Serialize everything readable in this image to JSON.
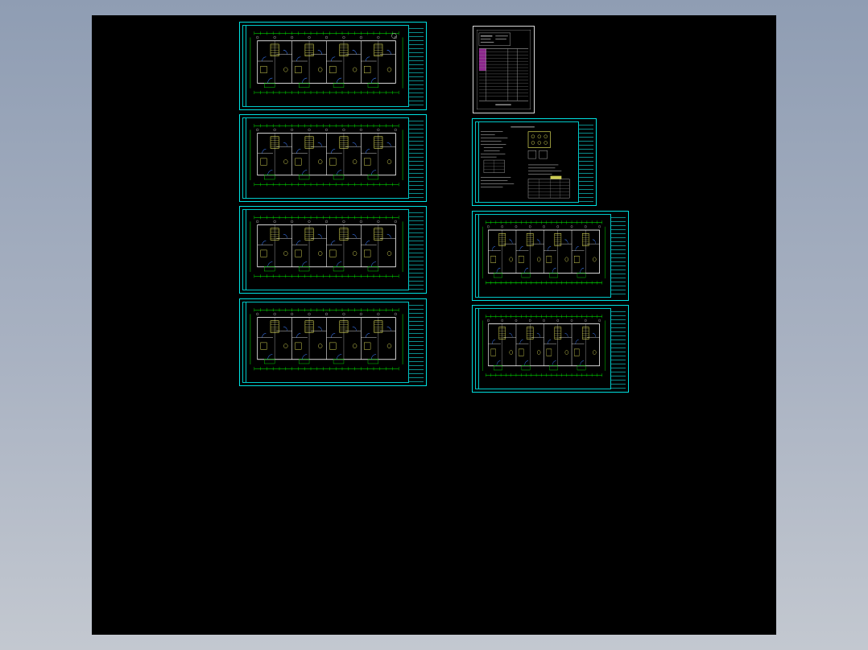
{
  "window": {
    "title": ""
  },
  "viewport": {
    "background": "#000000",
    "frame_color": "#00e0e0",
    "plan_colors": {
      "wall": "#ffffff",
      "dimension": "#00ff00",
      "furniture": "#ffff66",
      "door": "#3d7dff",
      "accent": "#ff44ff"
    }
  },
  "sheets": [
    {
      "id": "floor-plan-1",
      "kind": "floor-plan",
      "caption": ""
    },
    {
      "id": "floor-plan-2",
      "kind": "floor-plan",
      "caption": ""
    },
    {
      "id": "floor-plan-3",
      "kind": "floor-plan",
      "caption": ""
    },
    {
      "id": "floor-plan-4",
      "kind": "floor-plan",
      "caption": ""
    },
    {
      "id": "drawing-index",
      "kind": "schedule",
      "caption": ""
    },
    {
      "id": "design-notes",
      "kind": "notes",
      "caption": ""
    },
    {
      "id": "floor-plan-5",
      "kind": "floor-plan",
      "caption": ""
    },
    {
      "id": "floor-plan-6",
      "kind": "floor-plan",
      "caption": ""
    }
  ]
}
